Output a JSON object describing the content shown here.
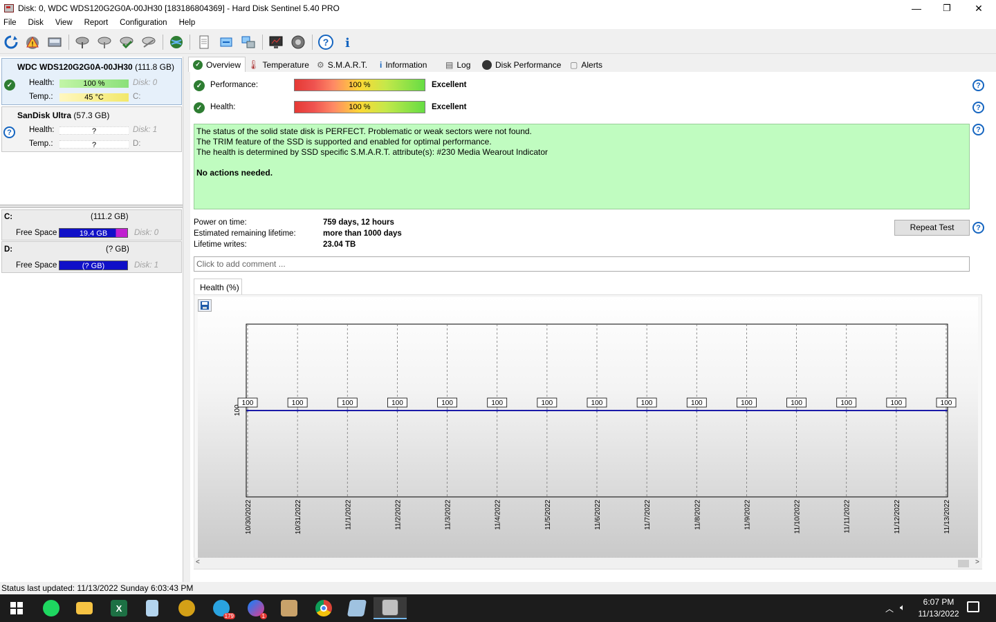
{
  "window": {
    "title": "Disk: 0, WDC WDS120G2G0A-00JH30 [183186804369]  -  Hard Disk Sentinel 5.40 PRO",
    "minimize": "—",
    "maximize": "❐",
    "close": "✕"
  },
  "menu": [
    "File",
    "Disk",
    "View",
    "Report",
    "Configuration",
    "Help"
  ],
  "toolbar": {
    "icons": [
      "refresh-icon",
      "alert-disk-icon",
      "disk-icon",
      "disk-tool-icon-1",
      "disk-tool-icon-2",
      "disk-check-icon",
      "disk-tool-icon-3",
      "globe-icon",
      "report-icon",
      "sync-icon",
      "network-icon",
      "monitor-icon",
      "speaker-icon",
      "help-icon",
      "info-icon"
    ]
  },
  "disks": [
    {
      "name": "WDC WDS120G2G0A-00JH30",
      "size": "(111.8 GB)",
      "health_label": "Health:",
      "health": "100 %",
      "health_fraction": 1.0,
      "disk": "Disk: 0",
      "temp_label": "Temp.:",
      "temp": "45 °C",
      "drive": "C:",
      "status": "ok"
    },
    {
      "name": "SanDisk Ultra",
      "size": "(57.3 GB)",
      "health_label": "Health:",
      "health": "?",
      "disk": "Disk: 1",
      "temp_label": "Temp.:",
      "temp": "?",
      "drive": "D:",
      "status": "unknown"
    }
  ],
  "volumes": [
    {
      "letter": "C:",
      "size": "(111.2 GB)",
      "free_label": "Free Space",
      "free": "19.4 GB",
      "used_fraction": 0.83,
      "disk": "Disk: 0"
    },
    {
      "letter": "D:",
      "size": "(? GB)",
      "free_label": "Free Space",
      "free": "(? GB)",
      "disk": "Disk: 1"
    }
  ],
  "tabs": [
    "Overview",
    "Temperature",
    "S.M.A.R.T.",
    "Information",
    "Log",
    "Disk Performance",
    "Alerts"
  ],
  "overview": {
    "performance_label": "Performance:",
    "performance_value": "100 %",
    "performance_rating": "Excellent",
    "health_label": "Health:",
    "health_value": "100 %",
    "health_rating": "Excellent",
    "status_lines": [
      "The status of the solid state disk is PERFECT. Problematic or weak sectors were not found.",
      "The TRIM feature of the SSD is supported and enabled for optimal performance.",
      "The health is determined by SSD specific S.M.A.R.T. attribute(s):  #230 Media Wearout Indicator"
    ],
    "status_action": "No actions needed.",
    "power_on_label": "Power on time:",
    "power_on_value": "759 days, 12 hours",
    "lifetime_label": "Estimated remaining lifetime:",
    "lifetime_value": "more than 1000 days",
    "writes_label": "Lifetime writes:",
    "writes_value": "23.04 TB",
    "repeat_button": "Repeat Test",
    "comment_placeholder": "Click to add comment ...",
    "chart_tab": "Health (%)"
  },
  "chart_data": {
    "type": "line",
    "title": "",
    "xlabel": "",
    "ylabel": "",
    "y_tick": "100",
    "categories": [
      "10/30/2022",
      "10/31/2022",
      "11/1/2022",
      "11/2/2022",
      "11/3/2022",
      "11/4/2022",
      "11/5/2022",
      "11/6/2022",
      "11/7/2022",
      "11/8/2022",
      "11/9/2022",
      "11/10/2022",
      "11/11/2022",
      "11/12/2022",
      "11/13/2022"
    ],
    "series": [
      {
        "values": [
          100,
          100,
          100,
          100,
          100,
          100,
          100,
          100,
          100,
          100,
          100,
          100,
          100,
          100,
          100
        ]
      }
    ],
    "grid": true,
    "line_color": "#1a1aa8"
  },
  "statusbar": "Status last updated: 11/13/2022 Sunday 6:03:43 PM",
  "taskbar": {
    "time": "6:07 PM",
    "date": "11/13/2022",
    "apps": [
      "start-icon",
      "spotify-icon",
      "file-explorer-icon",
      "excel-icon",
      "notepad-icon",
      "app-icon-1",
      "telegram-icon",
      "messenger-icon",
      "game-icon",
      "chrome-icon",
      "notes-icon",
      "hard-disk-sentinel-icon"
    ],
    "telegram_badge": "179",
    "messenger_badge": "1"
  }
}
